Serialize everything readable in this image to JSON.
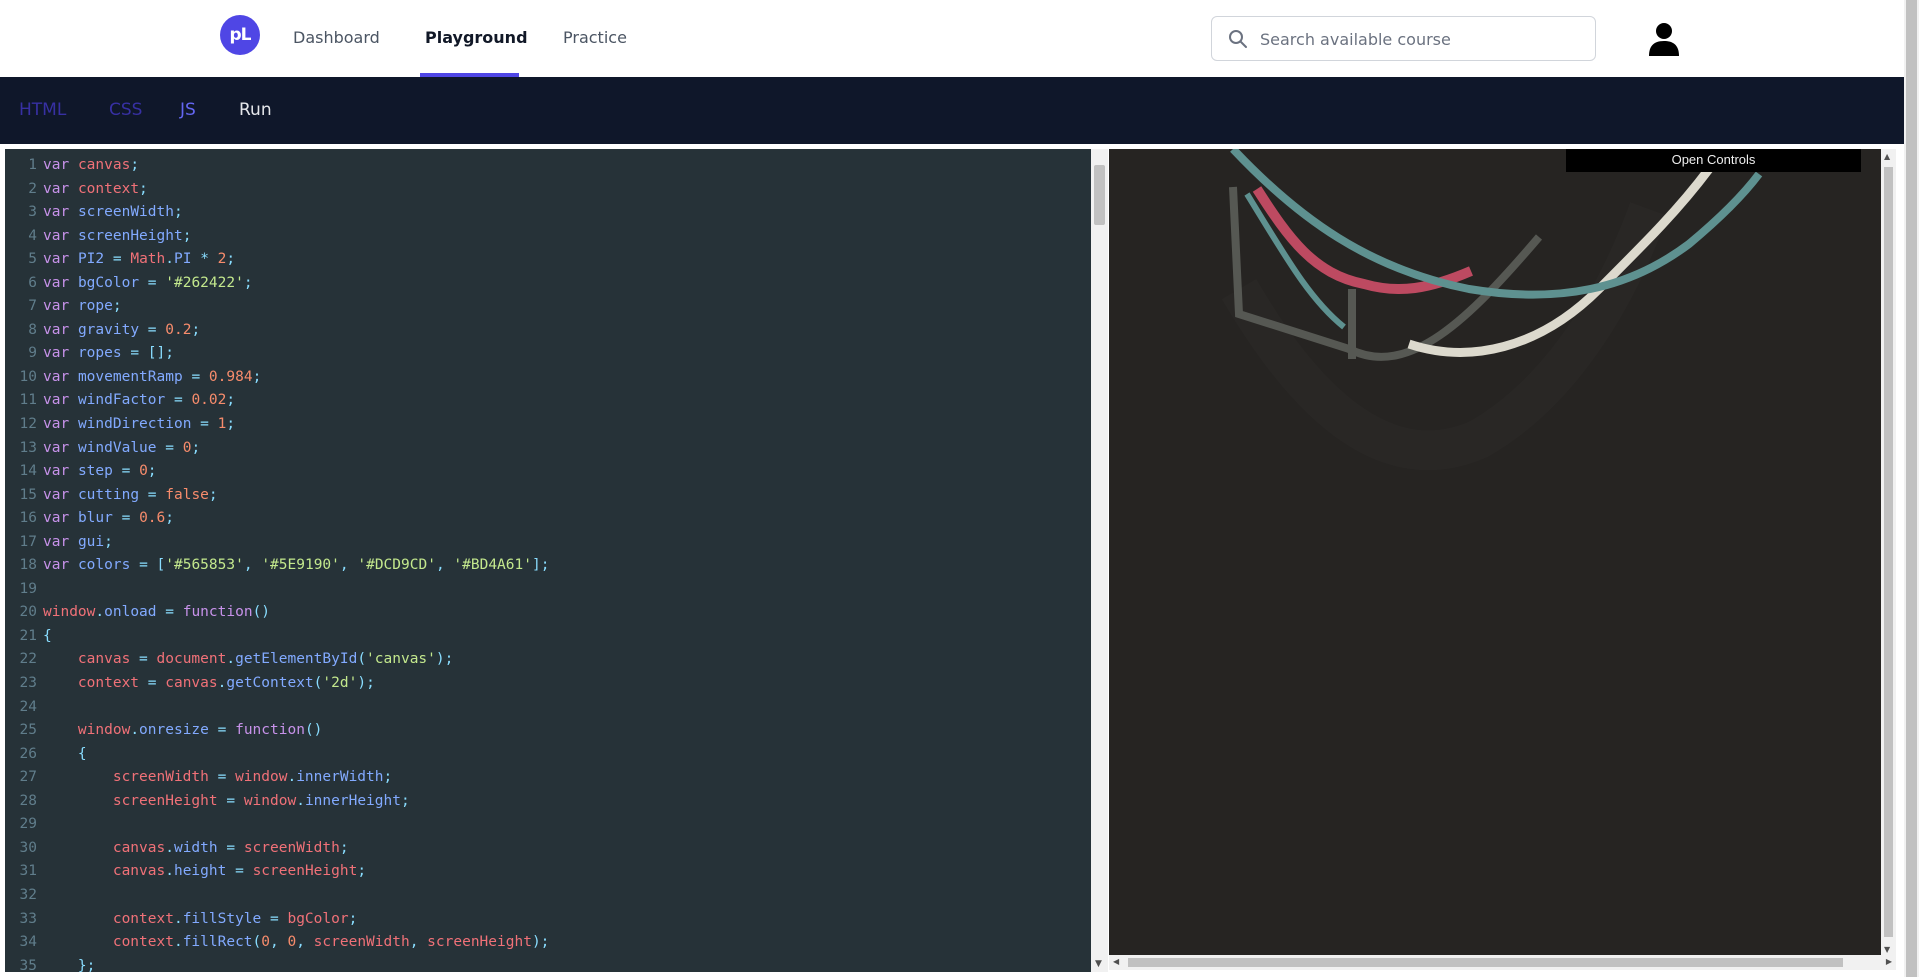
{
  "nav": {
    "logo": "pL",
    "links": [
      "Dashboard",
      "Playground",
      "Practice"
    ],
    "active": "Playground",
    "search_placeholder": "Search available course"
  },
  "tabs": {
    "html": "HTML",
    "css": "CSS",
    "js": "JS",
    "run": "Run"
  },
  "preview": {
    "controls_button": "Open Controls",
    "background": "#262422"
  },
  "editor": {
    "language": "JS",
    "lines": [
      "var canvas;",
      "var context;",
      "var screenWidth;",
      "var screenHeight;",
      "var PI2 = Math.PI * 2;",
      "var bgColor = '#262422';",
      "var rope;",
      "var gravity = 0.2;",
      "var ropes = [];",
      "var movementRamp = 0.984;",
      "var windFactor = 0.02;",
      "var windDirection = 1;",
      "var windValue = 0;",
      "var step = 0;",
      "var cutting = false;",
      "var blur = 0.6;",
      "var gui;",
      "var colors = ['#565853', '#5E9190', '#DCD9CD', '#BD4A61'];",
      "",
      "window.onload = function()",
      "{",
      "    canvas = document.getElementById('canvas');",
      "    context = canvas.getContext('2d');",
      "",
      "    window.onresize = function()",
      "    {",
      "        screenWidth = window.innerWidth;",
      "        screenHeight = window.innerHeight;",
      "",
      "        canvas.width = screenWidth;",
      "        canvas.height = screenHeight;",
      "",
      "        context.fillStyle = bgColor;",
      "        context.fillRect(0, 0, screenWidth, screenHeight);",
      "    };"
    ]
  },
  "colors": {
    "accent": "#4f46e5",
    "editor_bg": "#263238",
    "tabbar_bg": "#0f172a"
  }
}
